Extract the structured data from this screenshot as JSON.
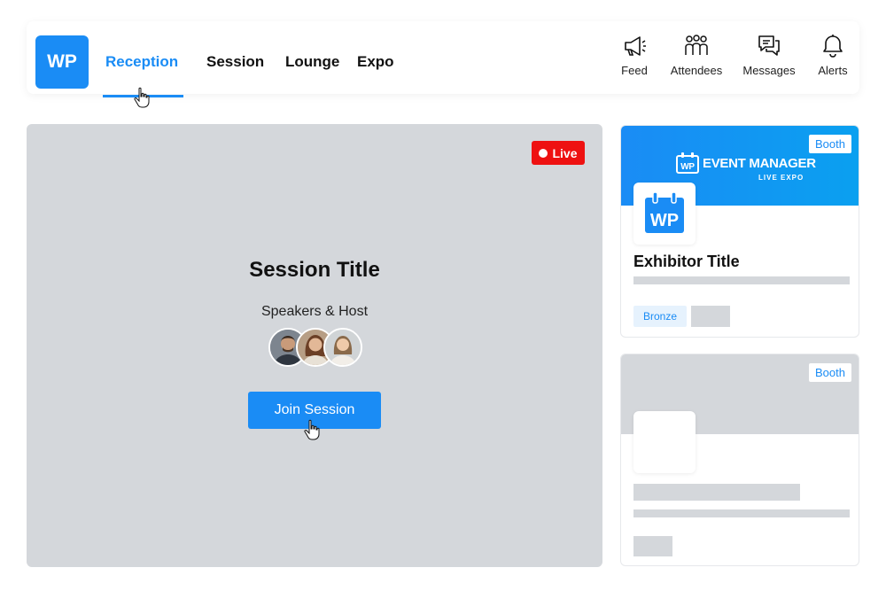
{
  "header": {
    "logo": "WP",
    "tabs": [
      {
        "label": "Reception",
        "active": true
      },
      {
        "label": "Session"
      },
      {
        "label": "Lounge"
      },
      {
        "label": "Expo"
      }
    ],
    "actions": [
      {
        "label": "Feed",
        "icon": "megaphone-icon"
      },
      {
        "label": "Attendees",
        "icon": "people-icon"
      },
      {
        "label": "Messages",
        "icon": "chat-icon"
      },
      {
        "label": "Alerts",
        "icon": "bell-icon"
      }
    ]
  },
  "stage": {
    "live_label": "Live",
    "title": "Session Title",
    "speakers_label": "Speakers & Host",
    "join_label": "Join Session"
  },
  "booths": [
    {
      "badge": "Booth",
      "brand": "EVENT MANAGER",
      "brand_logo": "WP",
      "brand_sub": "LIVE EXPO",
      "logo": "WP",
      "title": "Exhibitor Title",
      "tier": "Bronze"
    },
    {
      "badge": "Booth"
    }
  ],
  "colors": {
    "accent": "#1a8cf5",
    "live": "#ee1111",
    "placeholder": "#d4d7db"
  }
}
